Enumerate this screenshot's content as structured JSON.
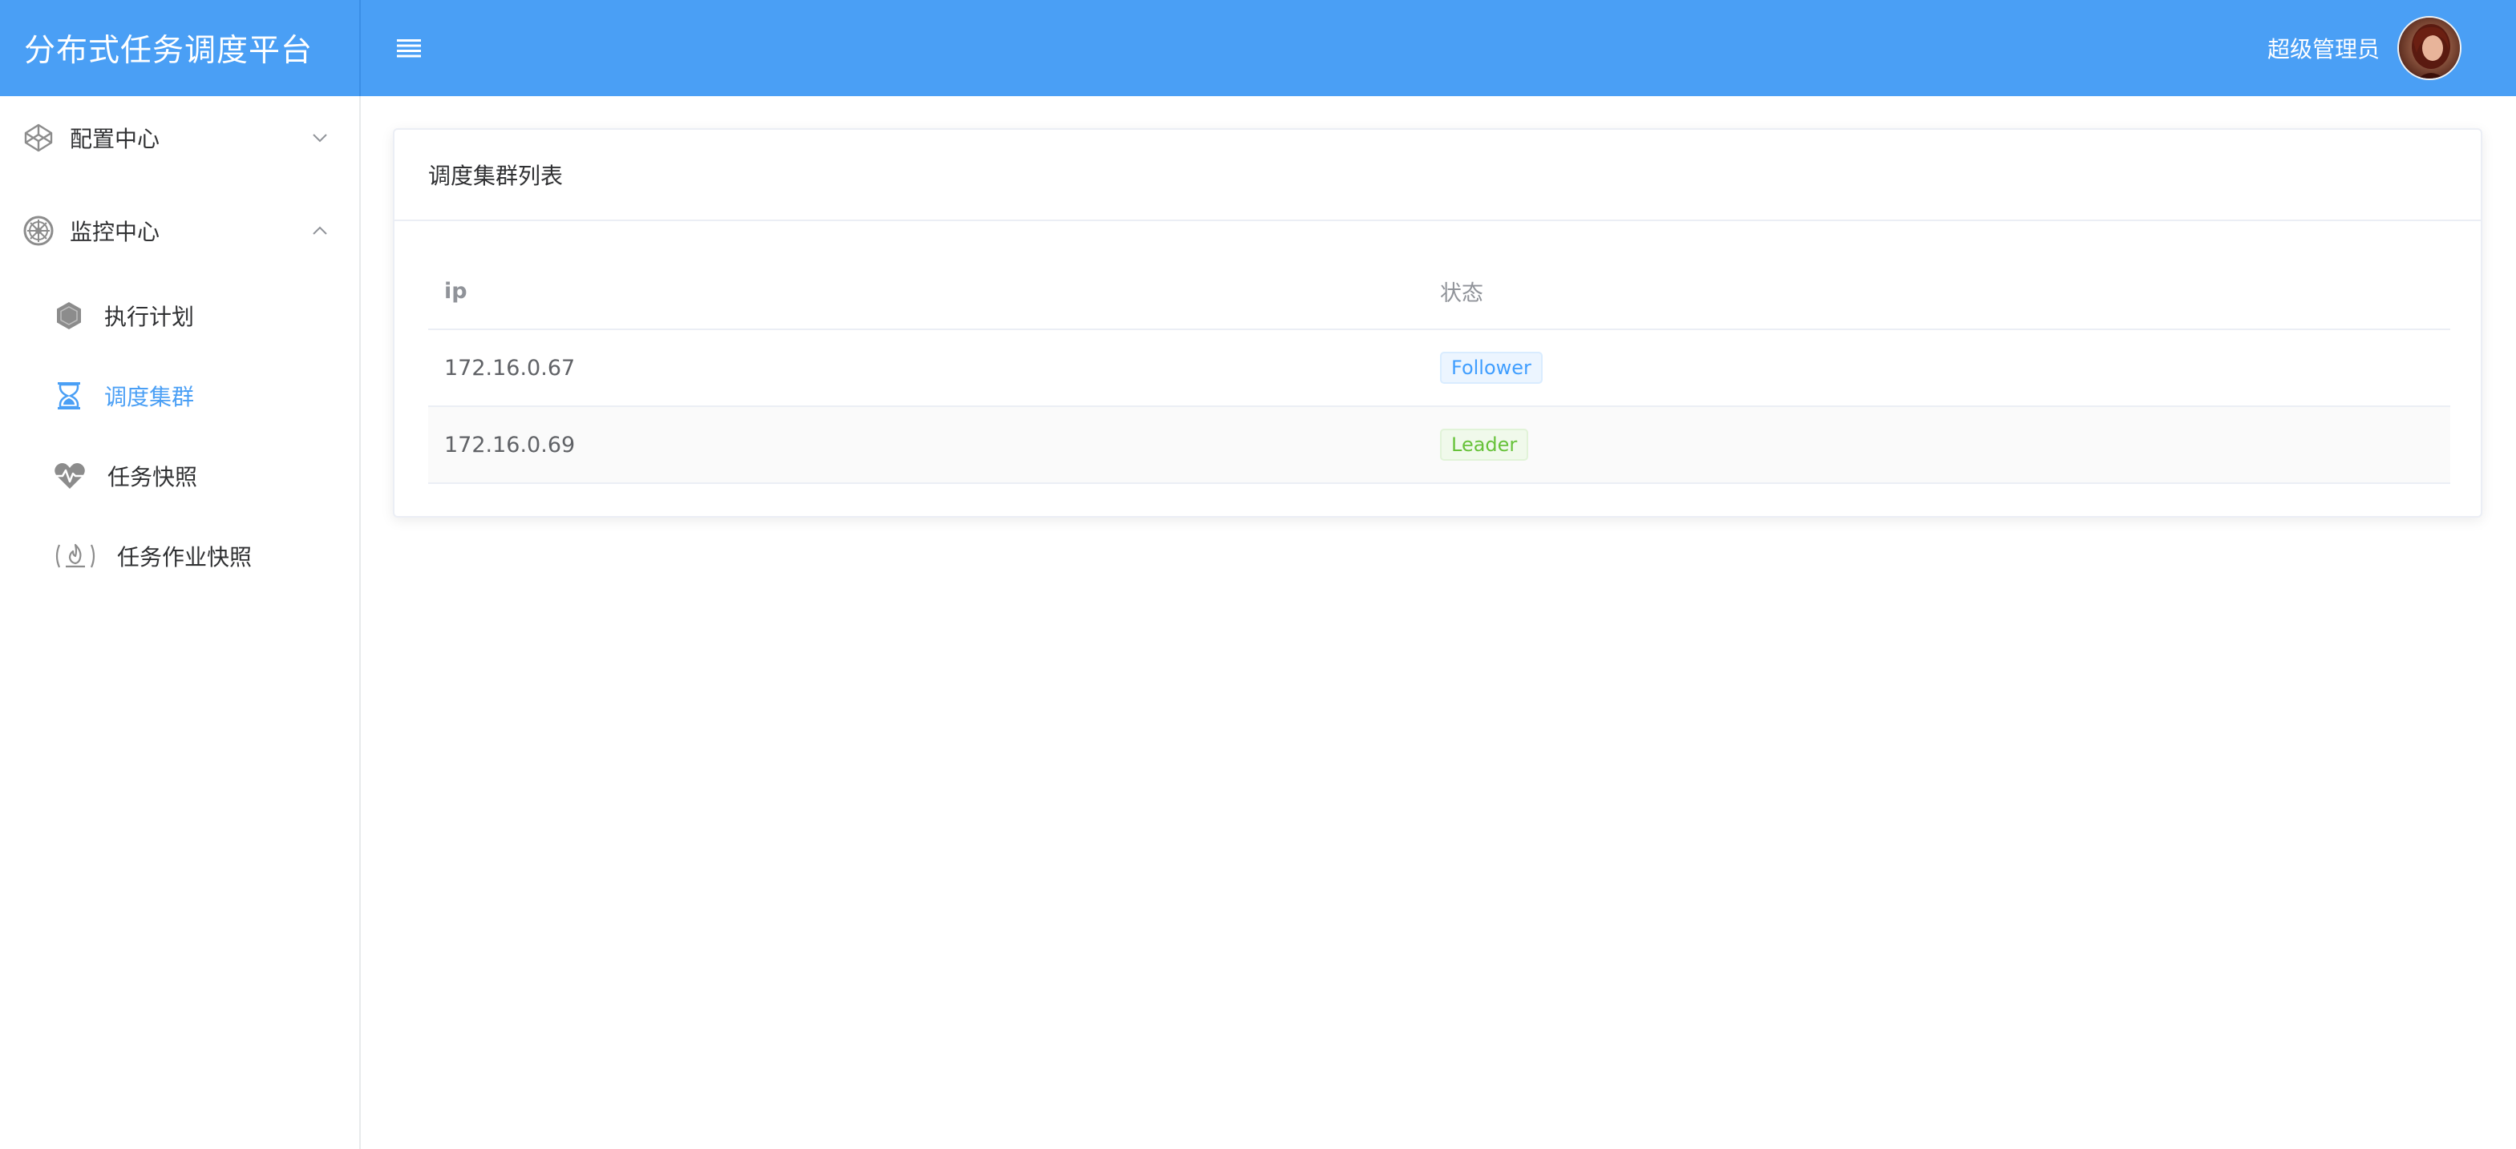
{
  "header": {
    "brand_title": "分布式任务调度平台",
    "user_name": "超级管理员",
    "accent_color": "#4a9ff5"
  },
  "sidebar": {
    "groups": [
      {
        "label": "配置中心",
        "icon": "codepen-icon",
        "expanded": false
      },
      {
        "label": "监控中心",
        "icon": "galactic-republic-icon",
        "expanded": true,
        "items": [
          {
            "label": "执行计划",
            "icon": "hexagon-icon",
            "active": false
          },
          {
            "label": "调度集群",
            "icon": "hourglass-icon",
            "active": true
          },
          {
            "label": "任务快照",
            "icon": "heartbeat-icon",
            "active": false
          },
          {
            "label": "任务作业快照",
            "icon": "fire-icon",
            "active": false
          }
        ]
      }
    ]
  },
  "main": {
    "card_title": "调度集群列表",
    "table": {
      "columns": [
        "ip",
        "状态"
      ],
      "rows": [
        {
          "ip": "172.16.0.67",
          "status": "Follower",
          "status_color": "#409eff"
        },
        {
          "ip": "172.16.0.69",
          "status": "Leader",
          "status_color": "#67c23a"
        }
      ]
    }
  }
}
